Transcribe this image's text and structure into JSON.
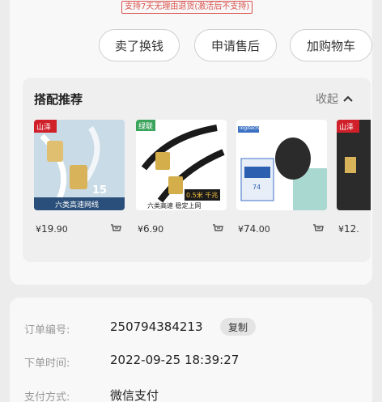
{
  "notice": "支持7天无理由退货(激活后不支持)",
  "actions": [
    "卖了换钱",
    "申请售后",
    "加购物车"
  ],
  "recommend": {
    "title": "搭配推荐",
    "collapse_label": "收起",
    "products": [
      {
        "yen": "¥",
        "price_int": "19",
        "price_dec": ".90",
        "brand": "山泽",
        "tag": "15",
        "caption": "六类高速网线",
        "icon": "cart-icon"
      },
      {
        "yen": "¥",
        "price_int": "6",
        "price_dec": ".90",
        "brand": "绿联",
        "tag": "0.5米 千兆",
        "caption": "六类高速 稳定上网",
        "icon": "cart-icon"
      },
      {
        "yen": "¥",
        "price_int": "74",
        "price_dec": ".00",
        "brand": "logitech",
        "tag": "74",
        "caption": "",
        "icon": "cart-icon"
      },
      {
        "yen": "¥",
        "price_int": "12",
        "price_dec": ".",
        "brand": "山泽",
        "tag": "",
        "caption": "",
        "icon": "cart-icon"
      }
    ]
  },
  "order": {
    "number_label": "订单编号:",
    "number_value": "250794384213",
    "copy_label": "复制",
    "time_label": "下单时间:",
    "time_value": "2022-09-25 18:39:27",
    "pay_label": "支付方式:",
    "pay_value": "微信支付"
  }
}
